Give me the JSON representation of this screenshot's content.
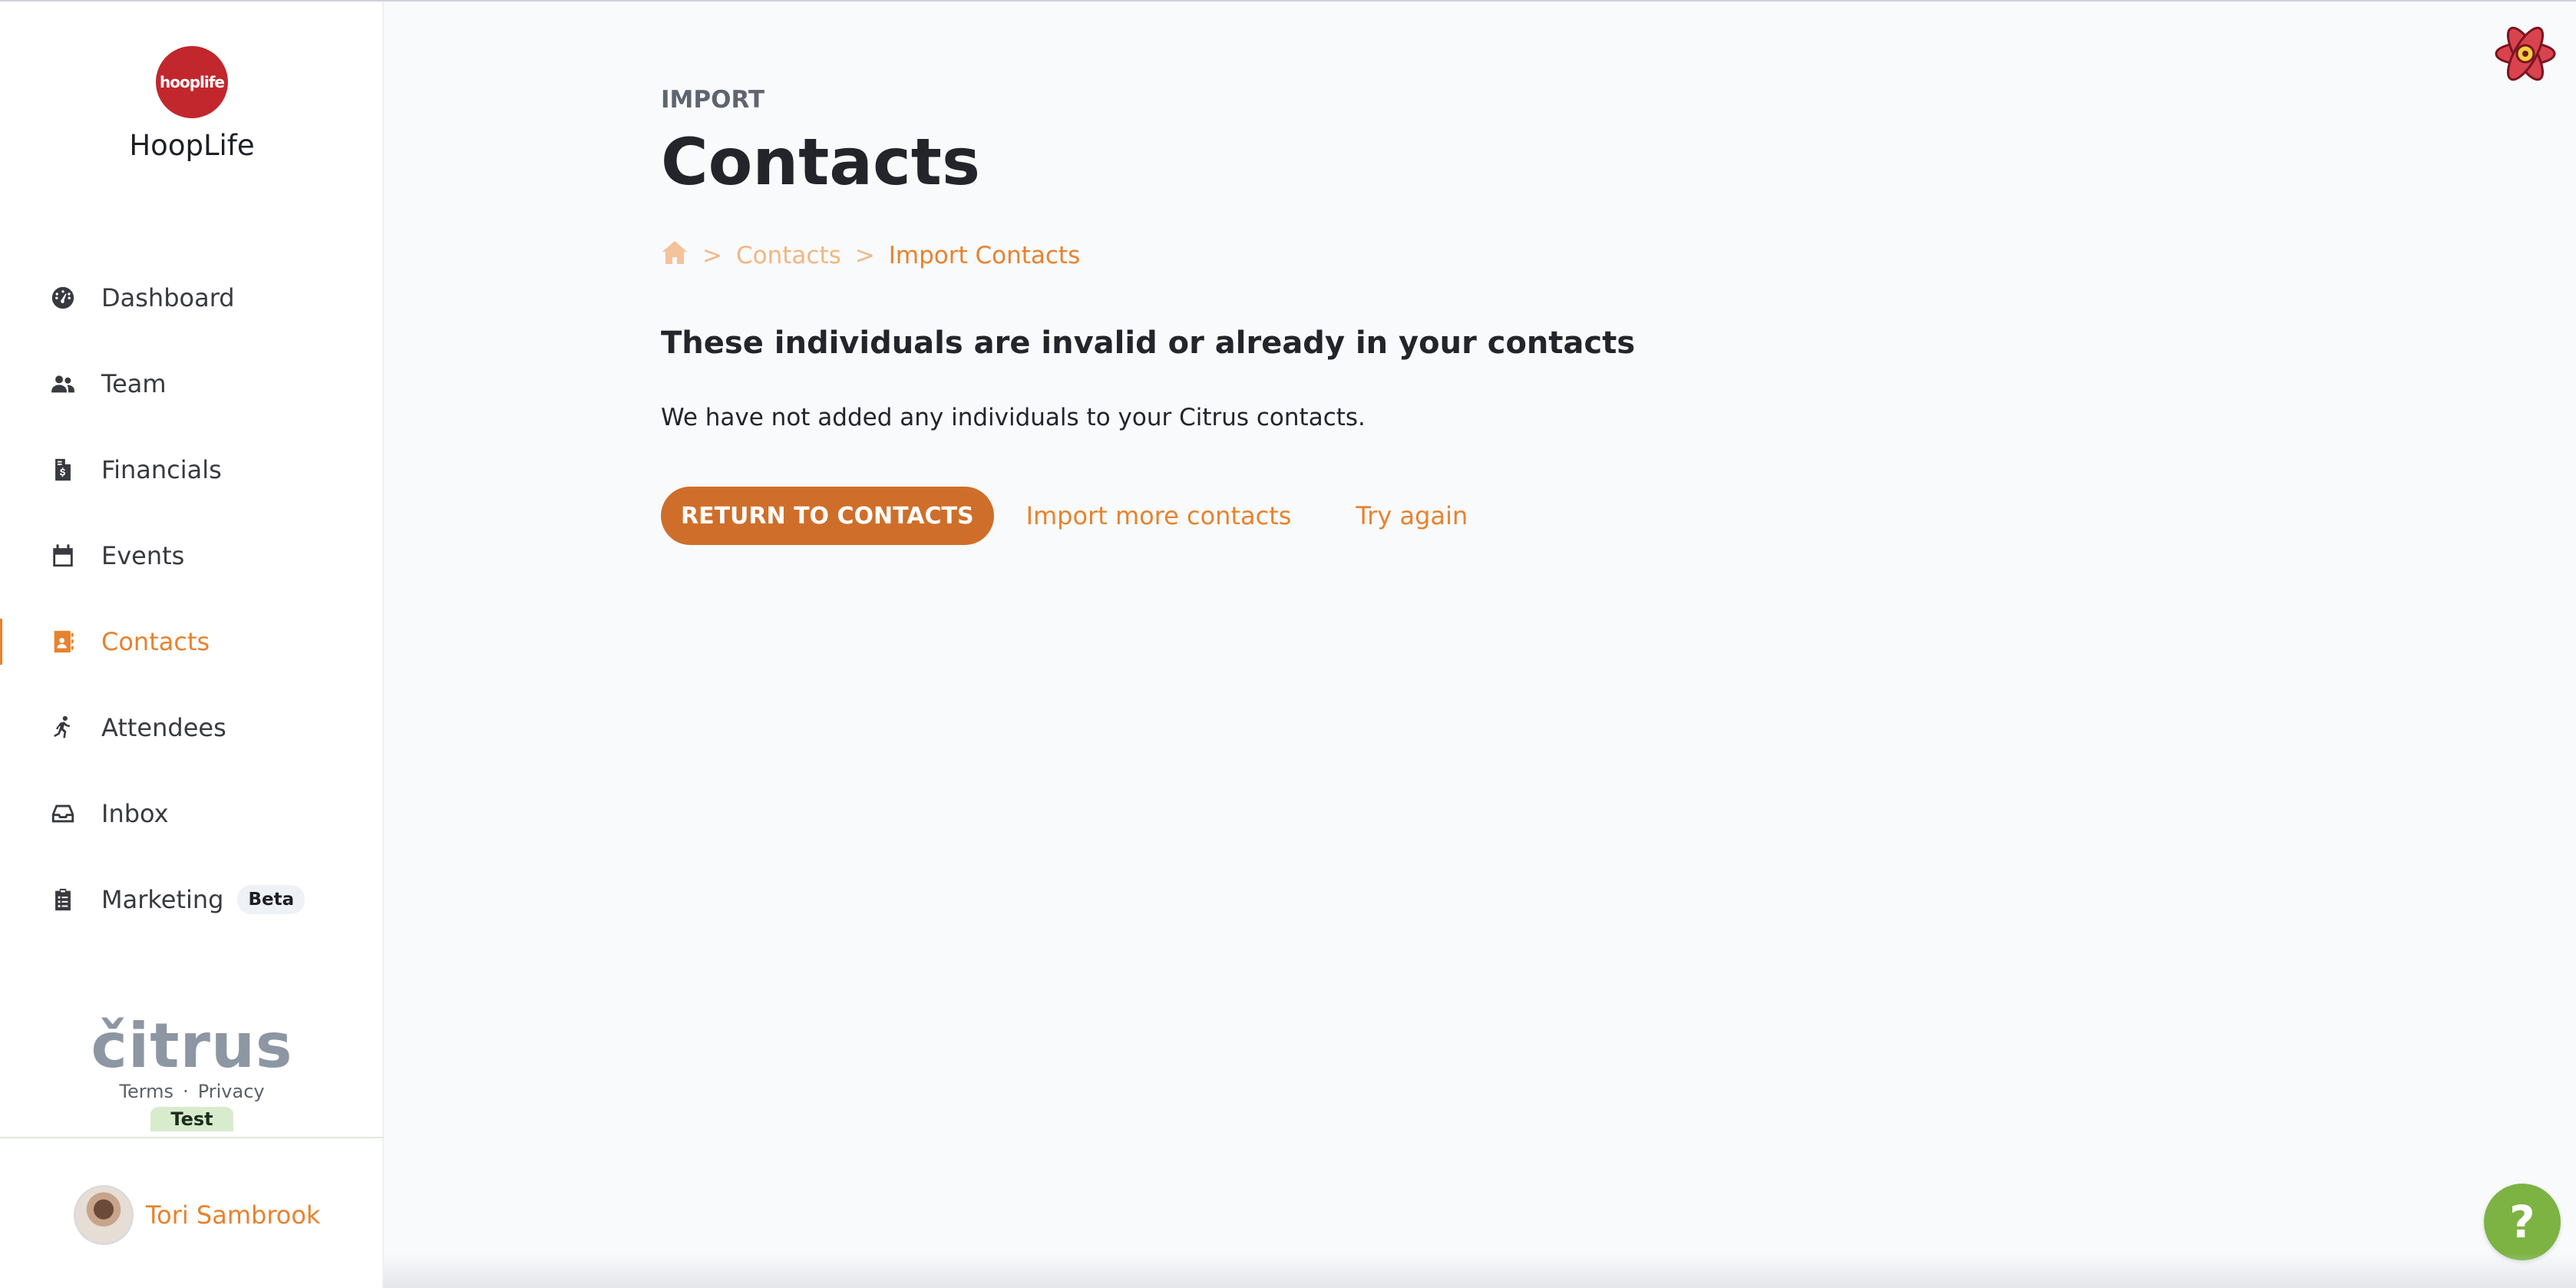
{
  "sidebar": {
    "brand_logo_text": "hooplife",
    "brand_name": "HoopLife",
    "nav": [
      {
        "label": "Dashboard",
        "icon": "gauge-icon"
      },
      {
        "label": "Team",
        "icon": "users-icon"
      },
      {
        "label": "Financials",
        "icon": "invoice-dollar-icon"
      },
      {
        "label": "Events",
        "icon": "calendar-icon"
      },
      {
        "label": "Contacts",
        "icon": "address-book-icon",
        "active": true
      },
      {
        "label": "Attendees",
        "icon": "running-person-icon"
      },
      {
        "label": "Inbox",
        "icon": "inbox-tray-icon"
      },
      {
        "label": "Marketing",
        "icon": "clipboard-list-icon",
        "badge": "Beta"
      }
    ],
    "footer": {
      "logo_text": "čitrus",
      "terms": "Terms",
      "separator": "·",
      "privacy": "Privacy",
      "env_badge": "Test"
    },
    "user": {
      "name": "Tori Sambrook"
    }
  },
  "main": {
    "eyebrow": "IMPORT",
    "title": "Contacts",
    "breadcrumb": {
      "separator": ">",
      "items": [
        "Contacts",
        "Import Contacts"
      ]
    },
    "heading": "These individuals are invalid or already in your contacts",
    "message": "We have not added any individuals to your Citrus contacts.",
    "actions": {
      "primary": "RETURN TO CONTACTS",
      "import_more": "Import more contacts",
      "try_again": "Try again"
    }
  },
  "help_button": "?",
  "colors": {
    "accent": "#e8822d",
    "primary_button": "#cf6e2a",
    "brand_red": "#c1272d",
    "help_green": "#7cb342"
  }
}
